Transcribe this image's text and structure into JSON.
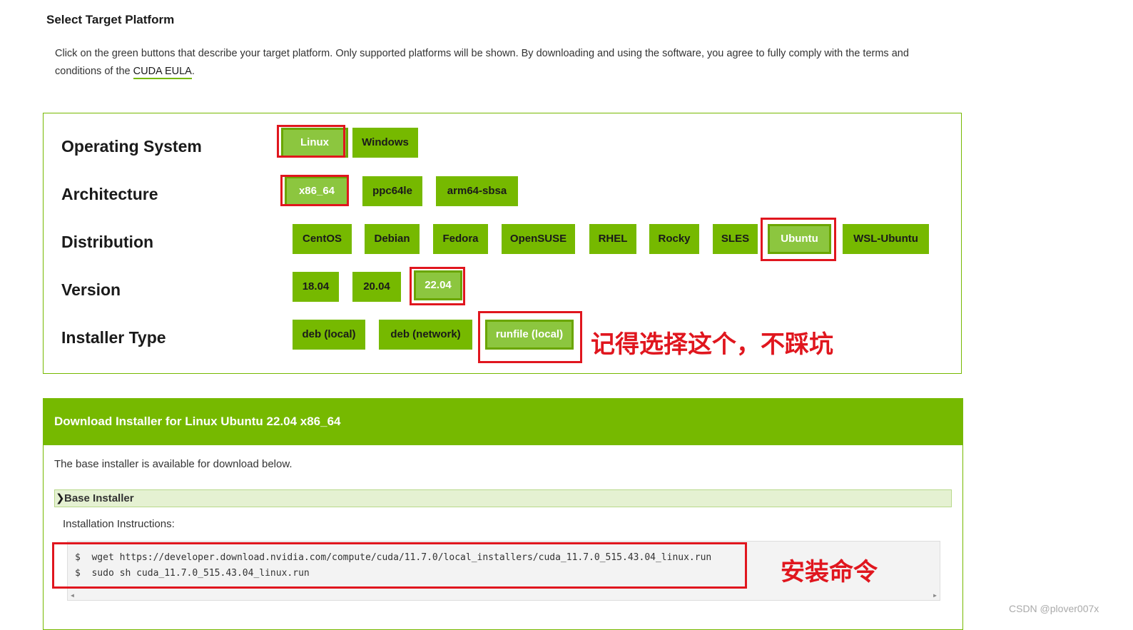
{
  "heading": "Select Target Platform",
  "intro": {
    "text_before": "Click on the green buttons that describe your target platform. Only supported platforms will be shown. By downloading and using the software, you agree to fully comply with the terms and conditions of the ",
    "eula_link": "CUDA EULA",
    "text_after": "."
  },
  "selector": {
    "os": {
      "label": "Operating System",
      "options": [
        "Linux",
        "Windows"
      ],
      "selected": "Linux"
    },
    "arch": {
      "label": "Architecture",
      "options": [
        "x86_64",
        "ppc64le",
        "arm64-sbsa"
      ],
      "selected": "x86_64"
    },
    "distro": {
      "label": "Distribution",
      "options": [
        "CentOS",
        "Debian",
        "Fedora",
        "OpenSUSE",
        "RHEL",
        "Rocky",
        "SLES",
        "Ubuntu",
        "WSL-Ubuntu"
      ],
      "selected": "Ubuntu"
    },
    "version": {
      "label": "Version",
      "options": [
        "18.04",
        "20.04",
        "22.04"
      ],
      "selected": "22.04"
    },
    "installer": {
      "label": "Installer Type",
      "options": [
        "deb (local)",
        "deb (network)",
        "runfile (local)"
      ],
      "selected": "runfile (local)"
    }
  },
  "annotations": {
    "installer_note": "记得选择这个，不踩坑",
    "command_note": "安装命令",
    "color": "#e0161e"
  },
  "download": {
    "header": "Download Installer for Linux Ubuntu 22.04 x86_64",
    "base_text": "The base installer is available for download below.",
    "section_title": "Base Installer",
    "instructions_label": "Installation Instructions:",
    "commands": [
      "$  wget https://developer.download.nvidia.com/compute/cuda/11.7.0/local_installers/cuda_11.7.0_515.43.04_linux.run",
      "$  sudo sh cuda_11.7.0_515.43.04_linux.run"
    ]
  },
  "watermark": "CSDN @plover007x",
  "colors": {
    "accent": "#76b900",
    "selected": "#8cc63f",
    "highlight": "#e0161e"
  }
}
